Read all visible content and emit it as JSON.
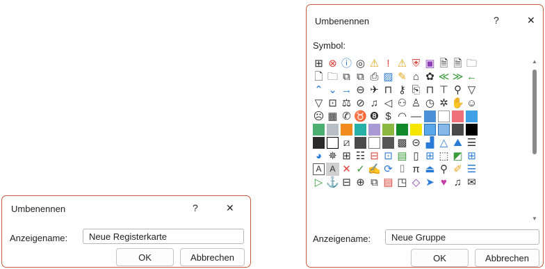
{
  "dialog1": {
    "title": "Umbenennen",
    "help": "?",
    "close": "✕",
    "display_name_label": "Anzeigename:",
    "display_name_value": "Neue Registerkarte",
    "ok": "OK",
    "cancel": "Abbrechen"
  },
  "dialog2": {
    "title": "Umbenennen",
    "help": "?",
    "close": "✕",
    "symbol_label": "Symbol:",
    "display_name_label": "Anzeigename:",
    "display_name_value": "Neue Gruppe",
    "ok": "OK",
    "cancel": "Abbrechen",
    "symbols": [
      {
        "name": "org-chart-icon",
        "glyph": "⊞",
        "color": "#2f2f2f"
      },
      {
        "name": "error-icon",
        "glyph": "⊗",
        "color": "#e0433a"
      },
      {
        "name": "info-icon",
        "glyph": "ⓘ",
        "color": "#2a7bd8"
      },
      {
        "name": "target-icon",
        "glyph": "◎",
        "color": "#2f2f2f"
      },
      {
        "name": "warning-icon",
        "glyph": "⚠",
        "color": "#e8a317"
      },
      {
        "name": "exclamation-icon",
        "glyph": "!",
        "color": "#e0433a"
      },
      {
        "name": "warning-alt-icon",
        "glyph": "⚠",
        "color": "#e8a317"
      },
      {
        "name": "shield-icon",
        "glyph": "⛨",
        "color": "#e0433a"
      },
      {
        "name": "save-icon",
        "glyph": "▣",
        "color": "#8e3fb8"
      },
      {
        "name": "document-check-icon",
        "glyph": "🗎",
        "color": "#2f2f2f"
      },
      {
        "name": "document-arrow-icon",
        "glyph": "🗎",
        "color": "#2f2f2f"
      },
      {
        "name": "folder-icon",
        "glyph": "🗀",
        "color": "#2f2f2f"
      },
      {
        "name": "document-icon",
        "glyph": "🗋",
        "color": "#2f2f2f"
      },
      {
        "name": "folder-open-icon",
        "glyph": "🗀",
        "color": "#2f2f2f"
      },
      {
        "name": "copy-icon",
        "glyph": "⧉",
        "color": "#2f2f2f"
      },
      {
        "name": "paste-icon",
        "glyph": "⧉",
        "color": "#2f2f2f"
      },
      {
        "name": "printer-icon",
        "glyph": "⎙",
        "color": "#2f2f2f"
      },
      {
        "name": "image-icon",
        "glyph": "▨",
        "color": "#2a7bd8"
      },
      {
        "name": "paint-icon",
        "glyph": "✎",
        "color": "#e8a317"
      },
      {
        "name": "home-icon",
        "glyph": "⌂",
        "color": "#2f2f2f"
      },
      {
        "name": "palette-icon",
        "glyph": "✿",
        "color": "#2f2f2f"
      },
      {
        "name": "double-left-icon",
        "glyph": "≪",
        "color": "#3a9b3a"
      },
      {
        "name": "double-right-icon",
        "glyph": "≫",
        "color": "#3a9b3a"
      },
      {
        "name": "arrow-left-icon",
        "glyph": "←",
        "color": "#3a9b3a"
      },
      {
        "name": "chevron-up-icon",
        "glyph": "⌃",
        "color": "#2a7bd8"
      },
      {
        "name": "chevron-down-icon",
        "glyph": "⌄",
        "color": "#2a7bd8"
      },
      {
        "name": "arrow-right-icon",
        "glyph": "→",
        "color": "#2a7bd8"
      },
      {
        "name": "back-circle-icon",
        "glyph": "⊖",
        "color": "#2f2f2f"
      },
      {
        "name": "pin-icon",
        "glyph": "✈",
        "color": "#2f2f2f"
      },
      {
        "name": "lock-icon",
        "glyph": "⊓",
        "color": "#2f2f2f"
      },
      {
        "name": "key-icon",
        "glyph": "⚷",
        "color": "#2f2f2f"
      },
      {
        "name": "scroll-icon",
        "glyph": "⎘",
        "color": "#2f2f2f"
      },
      {
        "name": "bookmark-icon",
        "glyph": "⊓",
        "color": "#2f2f2f"
      },
      {
        "name": "presentation-icon",
        "glyph": "⊤",
        "color": "#2f2f2f"
      },
      {
        "name": "search-icon",
        "glyph": "⚲",
        "color": "#2f2f2f"
      },
      {
        "name": "filter-icon",
        "glyph": "▽",
        "color": "#2f2f2f"
      },
      {
        "name": "filter-alt-icon",
        "glyph": "▽",
        "color": "#2f2f2f"
      },
      {
        "name": "contact-card-icon",
        "glyph": "⊡",
        "color": "#2f2f2f"
      },
      {
        "name": "scales-icon",
        "glyph": "⚖",
        "color": "#2f2f2f"
      },
      {
        "name": "no-entry-icon",
        "glyph": "⊘",
        "color": "#2f2f2f"
      },
      {
        "name": "microphone-icon",
        "glyph": "♫",
        "color": "#2f2f2f"
      },
      {
        "name": "speaker-mute-icon",
        "glyph": "◁",
        "color": "#2f2f2f"
      },
      {
        "name": "people-icon",
        "glyph": "⚇",
        "color": "#2f2f2f"
      },
      {
        "name": "person-icon",
        "glyph": "♙",
        "color": "#2f2f2f"
      },
      {
        "name": "clock-icon",
        "glyph": "◷",
        "color": "#2f2f2f"
      },
      {
        "name": "settings-icon",
        "glyph": "✲",
        "color": "#2f2f2f"
      },
      {
        "name": "hand-icon",
        "glyph": "✋",
        "color": "#2f2f2f"
      },
      {
        "name": "smiley-icon",
        "glyph": "☺",
        "color": "#2f2f2f"
      },
      {
        "name": "sad-face-icon",
        "glyph": "☹",
        "color": "#2f2f2f"
      },
      {
        "name": "calculator-icon",
        "glyph": "▦",
        "color": "#2f2f2f"
      },
      {
        "name": "phone-icon",
        "glyph": "✆",
        "color": "#2f2f2f"
      },
      {
        "name": "piggy-bank-icon",
        "glyph": "♉",
        "color": "#2f2f2f"
      },
      {
        "name": "number-8-icon",
        "glyph": "❽",
        "color": "#2f2f2f"
      },
      {
        "name": "currency-icon",
        "glyph": "$",
        "color": "#2f2f2f"
      },
      {
        "name": "eye-icon",
        "glyph": "◠",
        "color": "#2f2f2f"
      },
      {
        "name": "dash-icon",
        "glyph": "—",
        "color": "#2f2f2f"
      },
      {
        "name": "tiles-icon",
        "swatch": "#4a90d9"
      },
      {
        "name": "white-swatch-icon",
        "swatch": "#ffffff",
        "border": "#9a9a9a"
      },
      {
        "name": "pink-swatch-icon",
        "swatch": "#f0707a"
      },
      {
        "name": "blue-swatch-icon",
        "swatch": "#3fa0e6"
      },
      {
        "name": "green-swatch-icon",
        "swatch": "#4caf72"
      },
      {
        "name": "gray-swatch-icon",
        "swatch": "#b8bec6"
      },
      {
        "name": "orange-swatch-icon",
        "swatch": "#f28c1e"
      },
      {
        "name": "teal-swatch-icon",
        "swatch": "#26b0a8"
      },
      {
        "name": "lilac-swatch-icon",
        "swatch": "#a99ad6"
      },
      {
        "name": "olive-swatch-icon",
        "swatch": "#8ab840"
      },
      {
        "name": "dark-green-swatch-icon",
        "swatch": "#128a2c"
      },
      {
        "name": "yellow-swatch-icon",
        "swatch": "#f5e500"
      },
      {
        "name": "light-blue-swatch-icon",
        "swatch": "#5ba8e8",
        "border": "#2a6fb8"
      },
      {
        "name": "pattern-blue-swatch-icon",
        "swatch": "#88b8e8",
        "border": "#2a6fb8"
      },
      {
        "name": "diagonal-swatch-icon",
        "swatch": "#4a4a4a"
      },
      {
        "name": "black-swatch-icon",
        "swatch": "#000000"
      },
      {
        "name": "black-bottom-swatch-icon",
        "swatch": "#2a2a2a"
      },
      {
        "name": "black-border-swatch-icon",
        "swatch": "#ffffff",
        "border": "#000000"
      },
      {
        "name": "diagonal-line-swatch-icon",
        "glyph": "⧄",
        "color": "#2f2f2f"
      },
      {
        "name": "gray-bottom-swatch-icon",
        "swatch": "#4a4a4a"
      },
      {
        "name": "empty-swatch-icon",
        "swatch": "#ffffff",
        "border": "#7a7a7a"
      },
      {
        "name": "dark-top-swatch-icon",
        "swatch": "#555555"
      },
      {
        "name": "checker-swatch-icon",
        "glyph": "▩",
        "color": "#2f2f2f"
      },
      {
        "name": "arrow-circle-icon",
        "glyph": "⊝",
        "color": "#2f2f2f"
      },
      {
        "name": "bar-chart-icon",
        "glyph": "▟",
        "color": "#2a7bd8"
      },
      {
        "name": "triangle-icon",
        "glyph": "△",
        "color": "#2a7bd8"
      },
      {
        "name": "mountain-icon",
        "glyph": "⛰",
        "color": "#2a7bd8"
      },
      {
        "name": "align-icon",
        "glyph": "☰",
        "color": "#2f2f2f"
      },
      {
        "name": "pie-chart-icon",
        "glyph": "◕",
        "color": "#2a7bd8"
      },
      {
        "name": "radar-chart-icon",
        "glyph": "✵",
        "color": "#2f2f2f"
      },
      {
        "name": "hierarchy-icon",
        "glyph": "⊞",
        "color": "#2f2f2f"
      },
      {
        "name": "document-lines-icon",
        "glyph": "☷",
        "color": "#2f2f2f"
      },
      {
        "name": "form-icon",
        "glyph": "⊟",
        "color": "#e0433a"
      },
      {
        "name": "form-link-icon",
        "glyph": "⊡",
        "color": "#2a7bd8"
      },
      {
        "name": "picture-icon",
        "glyph": "▤",
        "color": "#3a9b3a"
      },
      {
        "name": "page-icon",
        "glyph": "▯",
        "color": "#2f2f2f"
      },
      {
        "name": "table-image-icon",
        "glyph": "⊞",
        "color": "#2a7bd8"
      },
      {
        "name": "resize-icon",
        "glyph": "⬚",
        "color": "#2f2f2f"
      },
      {
        "name": "shapes-icon",
        "glyph": "◩",
        "color": "#3a9b3a"
      },
      {
        "name": "layout-icon",
        "glyph": "⊞",
        "color": "#2a7bd8"
      },
      {
        "name": "letter-a-icon",
        "glyph": "A",
        "color": "#2f2f2f",
        "boxed": true
      },
      {
        "name": "letter-a-filled-icon",
        "glyph": "A",
        "color": "#2f2f2f",
        "fill": "#cfcfcf"
      },
      {
        "name": "delete-x-icon",
        "glyph": "✕",
        "color": "#e0433a"
      },
      {
        "name": "checkmark-icon",
        "glyph": "✓",
        "color": "#3a9b3a"
      },
      {
        "name": "sign-icon",
        "glyph": "✍",
        "color": "#2f2f2f"
      },
      {
        "name": "refresh-icon",
        "glyph": "⟳",
        "color": "#2a7bd8"
      },
      {
        "name": "bracket-icon",
        "glyph": "⌷",
        "color": "#2f2f2f"
      },
      {
        "name": "pi-icon",
        "glyph": "π",
        "color": "#2f2f2f"
      },
      {
        "name": "shape-fill-icon",
        "glyph": "⏏",
        "color": "#2a7bd8"
      },
      {
        "name": "find-icon",
        "glyph": "⚲",
        "color": "#2f2f2f"
      },
      {
        "name": "brush-icon",
        "glyph": "✐",
        "color": "#e8a317"
      },
      {
        "name": "list-icon",
        "glyph": "☰",
        "color": "#2a7bd8"
      },
      {
        "name": "play-icon",
        "glyph": "▷",
        "color": "#3a9b3a"
      },
      {
        "name": "anchor-icon",
        "glyph": "⚓",
        "color": "#2a7bd8"
      },
      {
        "name": "briefcase-icon",
        "glyph": "⊟",
        "color": "#2f2f2f"
      },
      {
        "name": "add-circle-icon",
        "glyph": "⊕",
        "color": "#2f2f2f"
      },
      {
        "name": "network-icon",
        "glyph": "⧉",
        "color": "#2f2f2f"
      },
      {
        "name": "spreadsheet-icon",
        "glyph": "▤",
        "color": "#e0433a"
      },
      {
        "name": "page-fold-icon",
        "glyph": "◳",
        "color": "#2f2f2f"
      },
      {
        "name": "eraser-icon",
        "glyph": "◇",
        "color": "#8e3fb8"
      },
      {
        "name": "send-icon",
        "glyph": "➤",
        "color": "#2a7bd8"
      },
      {
        "name": "heart-icon",
        "glyph": "♥",
        "color": "#c23fa8"
      },
      {
        "name": "bell-icon",
        "glyph": "♫",
        "color": "#2f2f2f"
      },
      {
        "name": "envelope-icon",
        "glyph": "✉",
        "color": "#2f2f2f"
      }
    ]
  }
}
